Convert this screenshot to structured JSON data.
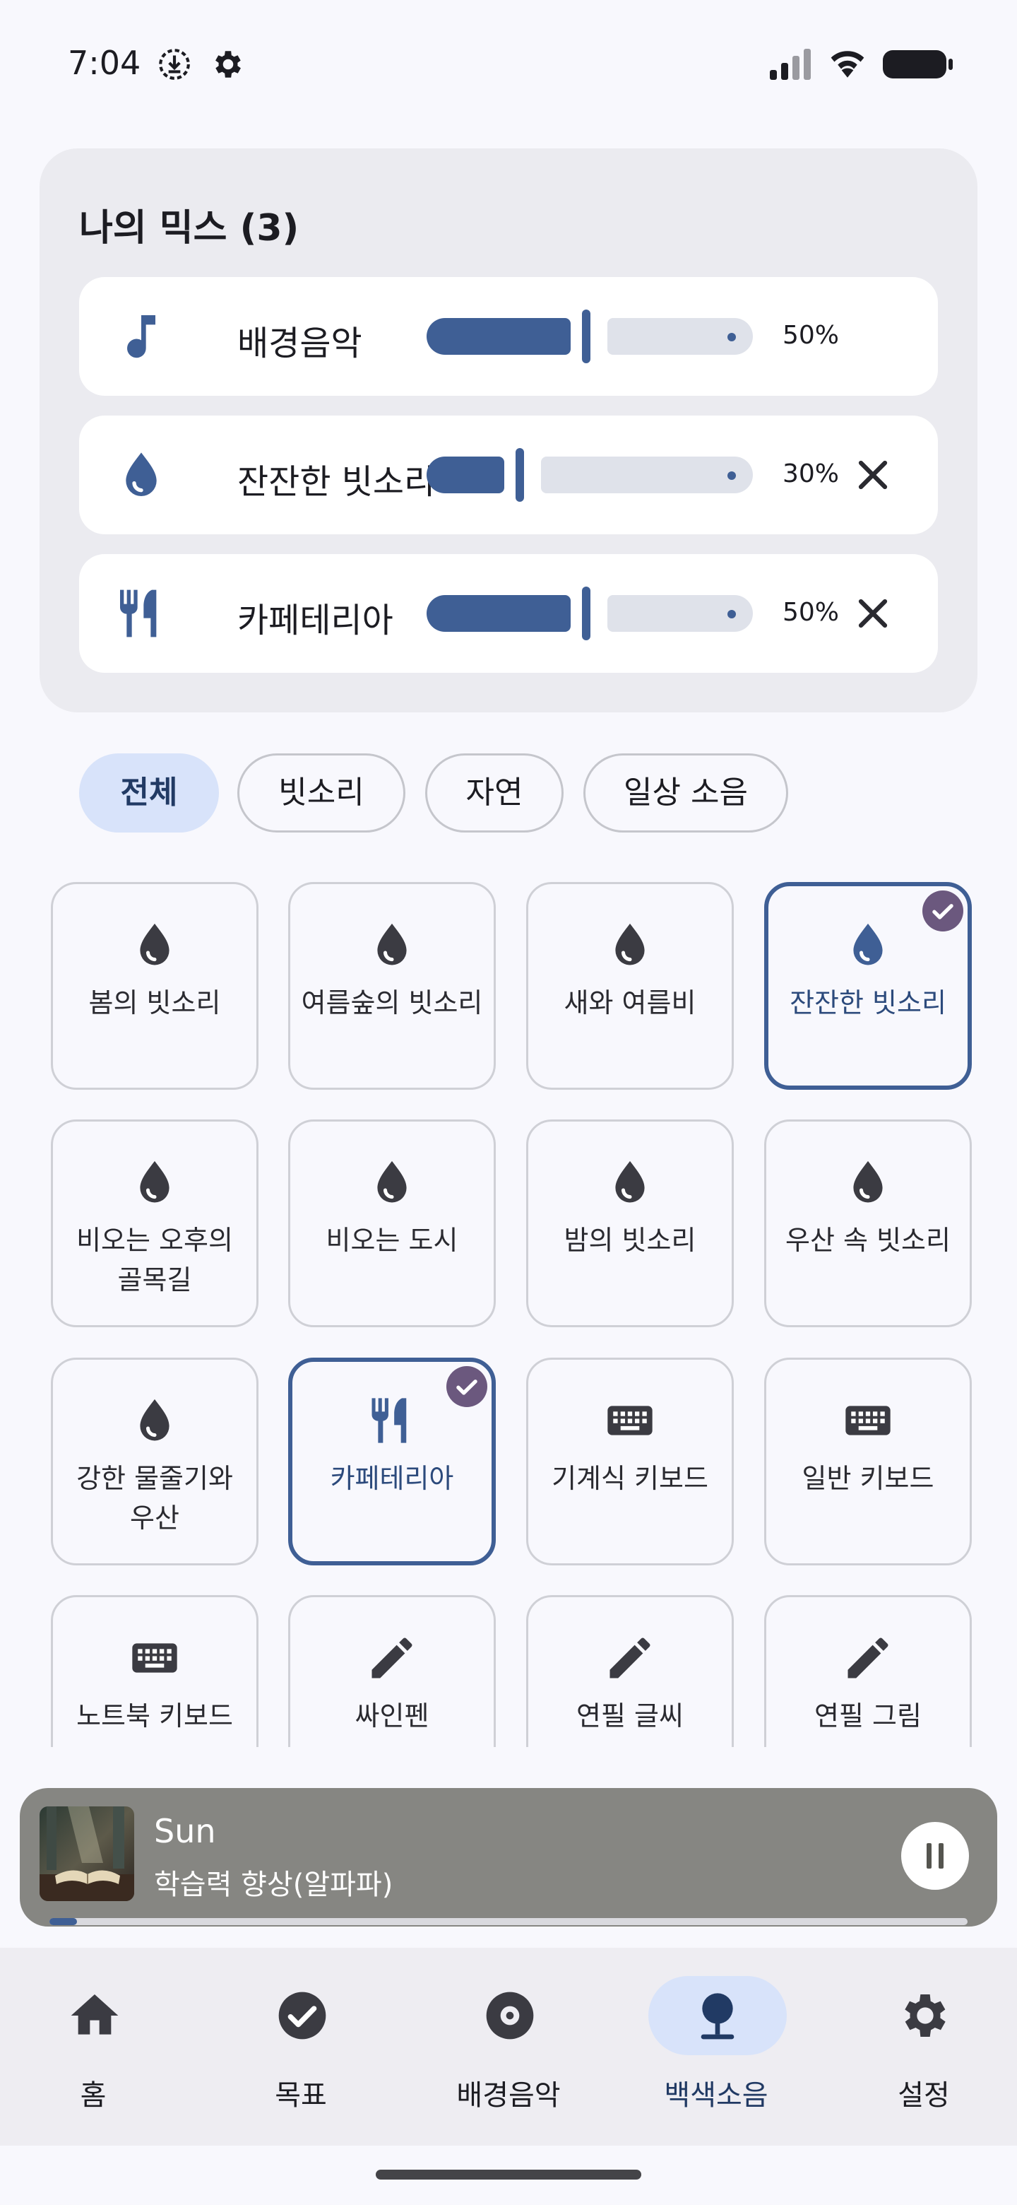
{
  "status_bar": {
    "time": "7:04"
  },
  "mix": {
    "title": "나의 믹스 (3)",
    "rows": [
      {
        "label": "배경음악",
        "icon": "music-note-icon",
        "percent": "50%",
        "volume": 0.5,
        "removable": false
      },
      {
        "label": "잔잔한 빗소리",
        "icon": "water-drop-icon",
        "percent": "30%",
        "volume": 0.3,
        "removable": true
      },
      {
        "label": "카페테리아",
        "icon": "restaurant-icon",
        "percent": "50%",
        "volume": 0.5,
        "removable": true
      }
    ]
  },
  "filters": [
    {
      "label": "전체",
      "selected": true
    },
    {
      "label": "빗소리",
      "selected": false
    },
    {
      "label": "자연",
      "selected": false
    },
    {
      "label": "일상 소음",
      "selected": false
    }
  ],
  "sounds": [
    {
      "label": "봄의 빗소리",
      "icon": "water-drop-icon",
      "selected": false
    },
    {
      "label": "여름숲의 빗소리",
      "icon": "water-drop-icon",
      "selected": false
    },
    {
      "label": "새와 여름비",
      "icon": "water-drop-icon",
      "selected": false
    },
    {
      "label": "잔잔한 빗소리",
      "icon": "water-drop-icon",
      "selected": true
    },
    {
      "label": "비오는 오후의 골목길",
      "icon": "water-drop-icon",
      "selected": false
    },
    {
      "label": "비오는 도시",
      "icon": "water-drop-icon",
      "selected": false
    },
    {
      "label": "밤의 빗소리",
      "icon": "water-drop-icon",
      "selected": false
    },
    {
      "label": "우산 속 빗소리",
      "icon": "water-drop-icon",
      "selected": false
    },
    {
      "label": "강한 물줄기와 우산",
      "icon": "water-drop-icon",
      "selected": false
    },
    {
      "label": "카페테리아",
      "icon": "restaurant-icon",
      "selected": true
    },
    {
      "label": "기계식 키보드",
      "icon": "keyboard-icon",
      "selected": false
    },
    {
      "label": "일반 키보드",
      "icon": "keyboard-icon",
      "selected": false
    },
    {
      "label": "노트북 키보드",
      "icon": "keyboard-icon",
      "selected": false
    },
    {
      "label": "싸인펜",
      "icon": "pencil-icon",
      "selected": false
    },
    {
      "label": "연필 글씨",
      "icon": "pencil-icon",
      "selected": false
    },
    {
      "label": "연필 그림",
      "icon": "pencil-icon",
      "selected": false
    }
  ],
  "now_playing": {
    "title": "Sun",
    "subtitle": "학습력 향상(알파파)",
    "progress": 0.03
  },
  "nav": [
    {
      "label": "홈",
      "icon": "home-icon",
      "active": false
    },
    {
      "label": "목표",
      "icon": "check-circle-icon",
      "active": false
    },
    {
      "label": "배경음악",
      "icon": "disc-icon",
      "active": false
    },
    {
      "label": "백색소음",
      "icon": "tree-icon",
      "active": true
    },
    {
      "label": "설정",
      "icon": "gear-icon",
      "active": false
    }
  ],
  "colors": {
    "accent": "#3f5f95",
    "icon_dark": "#3b3b42",
    "check": "#6b587e"
  }
}
